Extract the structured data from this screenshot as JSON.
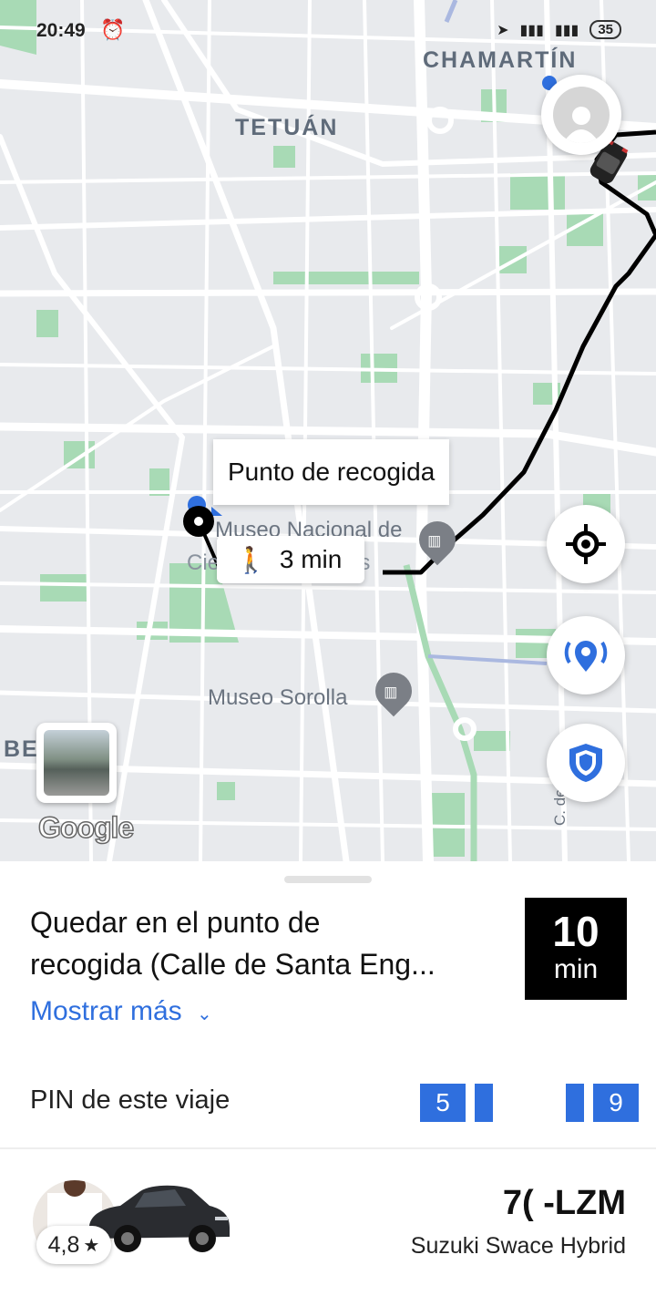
{
  "status_bar": {
    "time": "20:49",
    "alarm_icon": "alarm-icon",
    "battery": "35"
  },
  "map": {
    "labels": {
      "chamartin": "CHAMARTÍN",
      "tetuan": "TETUÁN",
      "be": "BE",
      "street": "C. de Ve"
    },
    "pois": {
      "museo_nacional_line1": "Museo Nacional de",
      "museo_nacional_line2": "Ciencias Naturales",
      "museo_sorolla": "Museo Sorolla"
    },
    "pickup_tooltip": "Punto de recogida",
    "walk_time": "3 min",
    "google_logo": "Google",
    "colors": {
      "route": "#000000",
      "park": "#a8dab5",
      "road": "#ffffff",
      "accent": "#2f6fde"
    }
  },
  "sheet": {
    "title_line1": "Quedar en el punto de",
    "title_line2": "recogida (Calle de Santa Eng...",
    "eta_value": "10",
    "eta_unit": "min",
    "show_more": "Mostrar más",
    "pin_label": "PIN de este viaje",
    "pin_digits": [
      "5",
      "",
      "",
      "9"
    ],
    "driver_rating": "4,8",
    "plate": "7(  -LZM",
    "car_model": "Suzuki Swace Hybrid"
  }
}
